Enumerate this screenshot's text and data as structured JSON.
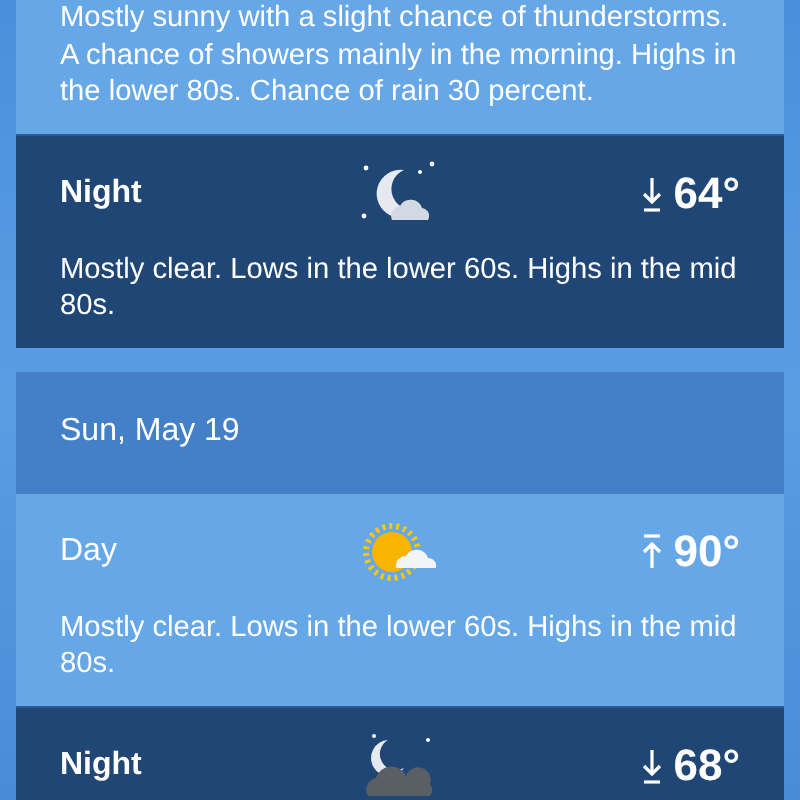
{
  "days": [
    {
      "periods": [
        {
          "kind": "day",
          "text": "Mostly sunny with a slight chance of thunderstorms. A chance of showers  mainly in the morning. Highs in the lower 80s. Chance of rain 30 percent."
        },
        {
          "kind": "night",
          "label": "Night",
          "temp": "64°",
          "text": "Mostly clear. Lows in the lower 60s. Highs in the mid 80s."
        }
      ]
    },
    {
      "date": "Sun, May 19",
      "periods": [
        {
          "kind": "day",
          "label": "Day",
          "temp": "90°",
          "text": "Mostly clear. Lows in the lower 60s. Highs in the mid 80s."
        },
        {
          "kind": "night",
          "label": "Night",
          "temp": "68°"
        }
      ]
    }
  ]
}
